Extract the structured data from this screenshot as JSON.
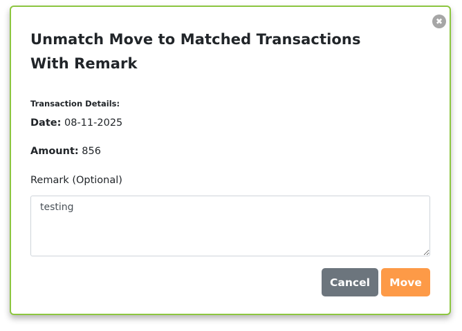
{
  "modal": {
    "title": "Unmatch Move to Matched Transactions With Remark",
    "close_glyph": "✖",
    "section_label": "Transaction Details:",
    "date_label": "Date:",
    "date_value": "08-11-2025",
    "amount_label": "Amount:",
    "amount_value": "856",
    "remark_label": "Remark (Optional)",
    "remark_value": "testing",
    "cancel_label": "Cancel",
    "move_label": "Move"
  },
  "colors": {
    "modal_border": "#8cc63f",
    "cancel_button": "#6c757d",
    "move_button": "#fd9a47",
    "close_button": "#a6a6a6"
  },
  "icons": {
    "close": "close-icon"
  }
}
